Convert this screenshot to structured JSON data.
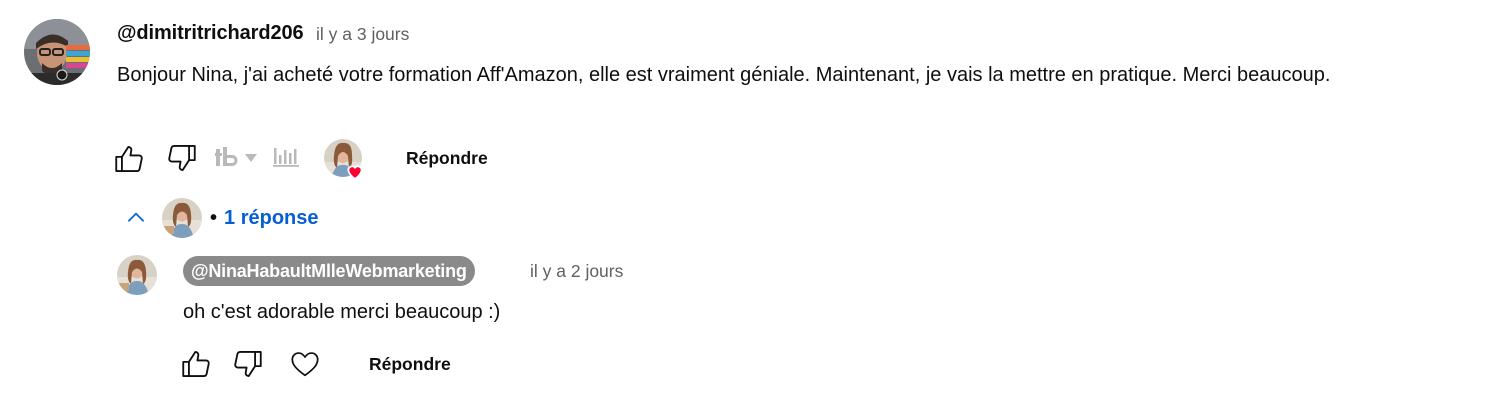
{
  "comment": {
    "author": "@dimitritrichard206",
    "time": "il y a 3 jours",
    "text": "Bonjour Nina, j'ai acheté votre formation Aff'Amazon, elle est vraiment géniale. Maintenant, je vais la mettre en pratique. Merci beaucoup.",
    "reply_label": "Répondre",
    "icons": [
      "thumb-up-icon",
      "thumb-down-icon",
      "tubebuddy-icon",
      "caret-down-icon",
      "stats-icon",
      "creator-heart-icon"
    ]
  },
  "replies_toggle": {
    "dot": "•",
    "label": "1 réponse",
    "icons": [
      "chevron-up-icon"
    ]
  },
  "reply": {
    "author": "@NinaHabaultMlleWebmarketing",
    "time": "il y a 2 jours",
    "text": "oh c'est adorable merci beaucoup :)",
    "reply_label": "Répondre",
    "icons": [
      "thumb-up-icon",
      "thumb-down-icon",
      "heart-icon"
    ]
  },
  "colors": {
    "link_blue": "#065fd4",
    "meta_gray": "#606060",
    "author_badge_bg": "#8a8a8a",
    "heart_red": "#ff0033"
  }
}
